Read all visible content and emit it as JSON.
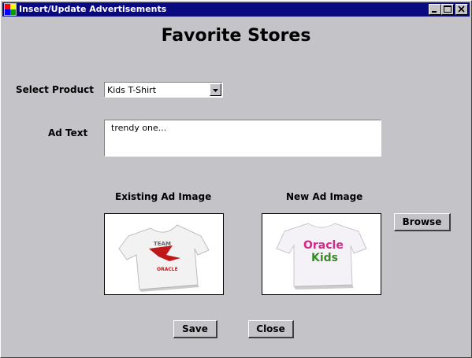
{
  "window": {
    "title": "Insert/Update  Advertisements"
  },
  "heading": "Favorite Stores",
  "product": {
    "label": "Select Product",
    "selected": "Kids T-Shirt"
  },
  "ad_text": {
    "label": "Ad Text",
    "value": "trendy one..."
  },
  "existing_image": {
    "label": "Existing Ad Image",
    "shirt_text_top": "TEAM",
    "shirt_text_bottom": "ORACLE"
  },
  "new_image": {
    "label": "New Ad Image",
    "shirt_text_line1": "Oracle",
    "shirt_text_line2": "Kids"
  },
  "buttons": {
    "browse": "Browse",
    "save": "Save",
    "close": "Close"
  },
  "colors": {
    "titlebar": "#0a0a80",
    "background": "#c4c3c8"
  }
}
